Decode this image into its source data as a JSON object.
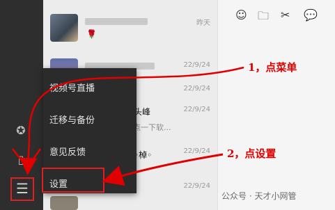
{
  "sidebar": {
    "icons": [
      "circle-logo-icon",
      "phone-icon"
    ],
    "menu_icon_glyph": "☰"
  },
  "chats": [
    {
      "time": "昨天",
      "emoji": "🌹"
    },
    {
      "time": "22/9/24"
    },
    {
      "time": "22/9/24"
    },
    {
      "time": "22/9/24",
      "title": "太头峰",
      "subtitle": "件点一下软..."
    },
    {
      "time": "22/9/24",
      "title": "征◦棹◦"
    },
    {
      "time": "22/9/24"
    }
  ],
  "popup_menu": {
    "items": [
      "视频号直播",
      "迁移与备份",
      "意见反馈",
      "设置"
    ]
  },
  "toolbar": {
    "emoji_glyph": "☺",
    "folder_glyph": "🗀",
    "scissors_glyph": "✂",
    "chat_glyph": "💬"
  },
  "annotations": {
    "step1": "1，点菜单",
    "step2": "2，点设置"
  },
  "watermark": "公众号 · 天才小网管",
  "colors": {
    "annotation_red": "#e00000",
    "sidebar_bg": "#2e2e2e",
    "popup_bg": "#2b2b2b"
  }
}
